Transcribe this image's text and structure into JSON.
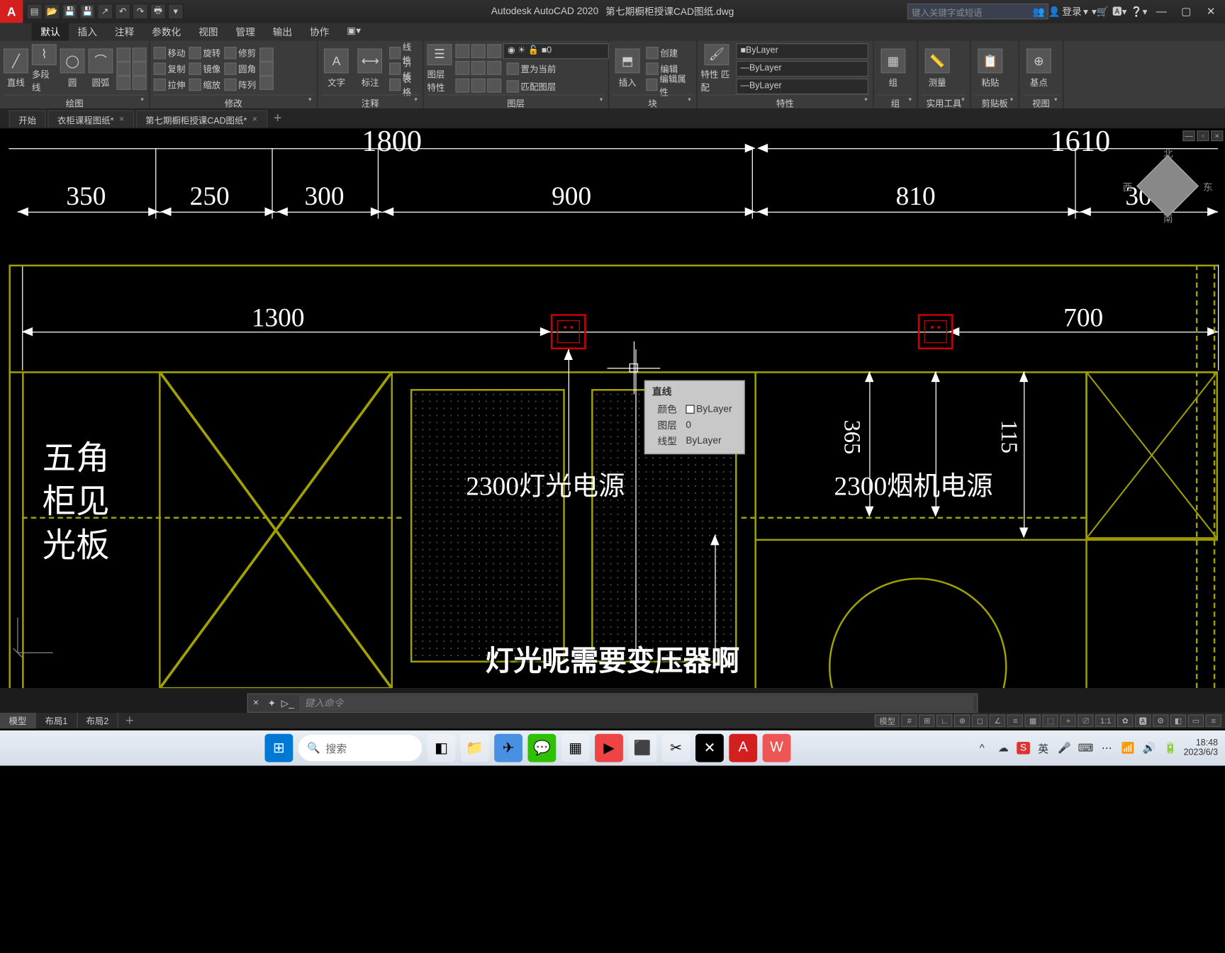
{
  "title": {
    "app": "Autodesk AutoCAD 2020",
    "file": "第七期橱柜授课CAD图纸.dwg"
  },
  "search_placeholder": "键入关键字或短语",
  "login": "登录",
  "menu": {
    "items": [
      "默认",
      "插入",
      "注释",
      "参数化",
      "视图",
      "管理",
      "输出",
      "协作"
    ],
    "active": 0
  },
  "ribbon": {
    "draw": {
      "title": "绘图",
      "line": "直线",
      "polyline": "多段线",
      "circle": "圆",
      "arc": "圆弧"
    },
    "modify": {
      "title": "修改",
      "move": "移动",
      "rotate": "旋转",
      "trim": "修剪",
      "copy": "复制",
      "mirror": "镜像",
      "fillet": "圆角",
      "stretch": "拉伸",
      "scale": "缩放",
      "array": "阵列"
    },
    "annot": {
      "title": "注释",
      "text": "文字",
      "dim": "标注",
      "leader": "引线",
      "table": "表格",
      "linear": "线性"
    },
    "layers": {
      "title": "图层",
      "props": "图层\n特性",
      "current_layer": "0",
      "setcurrent": "置为当前",
      "match": "匹配图层"
    },
    "block": {
      "title": "块",
      "insert": "插入",
      "create": "创建",
      "edit": "编辑",
      "attr": "编辑属性"
    },
    "props": {
      "title": "特性",
      "match": "特性\n匹配",
      "color": "ByLayer",
      "lw": "ByLayer",
      "lt": "ByLayer"
    },
    "group": {
      "title": "组",
      "label": "组"
    },
    "utils": {
      "title": "实用工具",
      "meas": "测量"
    },
    "clip": {
      "title": "剪贴板",
      "paste": "粘贴"
    },
    "view": {
      "title": "视图",
      "base": "基点"
    }
  },
  "filetabs": [
    {
      "label": "开始",
      "closable": false
    },
    {
      "label": "衣柜课程图纸*",
      "closable": true
    },
    {
      "label": "第七期橱柜授课CAD图纸*",
      "closable": true
    }
  ],
  "drawing": {
    "dims_top1": [
      "1800",
      "1610"
    ],
    "dims_top2": [
      "350",
      "250",
      "300",
      "900",
      "810",
      "300"
    ],
    "dims_mid": [
      "1300",
      "700"
    ],
    "vdim1": "365",
    "vdim2": "115",
    "label1": "2300灯光电源",
    "label2": "2300烟机电源",
    "side_text": "五角\n柜见\n光板",
    "compass": {
      "n": "北",
      "s": "南",
      "e": "东",
      "w": "西"
    }
  },
  "tooltip": {
    "title": "直线",
    "rows": [
      [
        "颜色",
        "ByLayer"
      ],
      [
        "图层",
        "0"
      ],
      [
        "线型",
        "ByLayer"
      ]
    ]
  },
  "subtitle": "灯光呢需要变压器啊",
  "cmd_placeholder": "键入命令",
  "layout_tabs": [
    "模型",
    "布局1",
    "布局2"
  ],
  "status": {
    "model": "模型",
    "scale": "1:1"
  },
  "taskbar": {
    "search": "搜索",
    "time": "18:48",
    "date": "2023/6/3",
    "ime": "英"
  }
}
